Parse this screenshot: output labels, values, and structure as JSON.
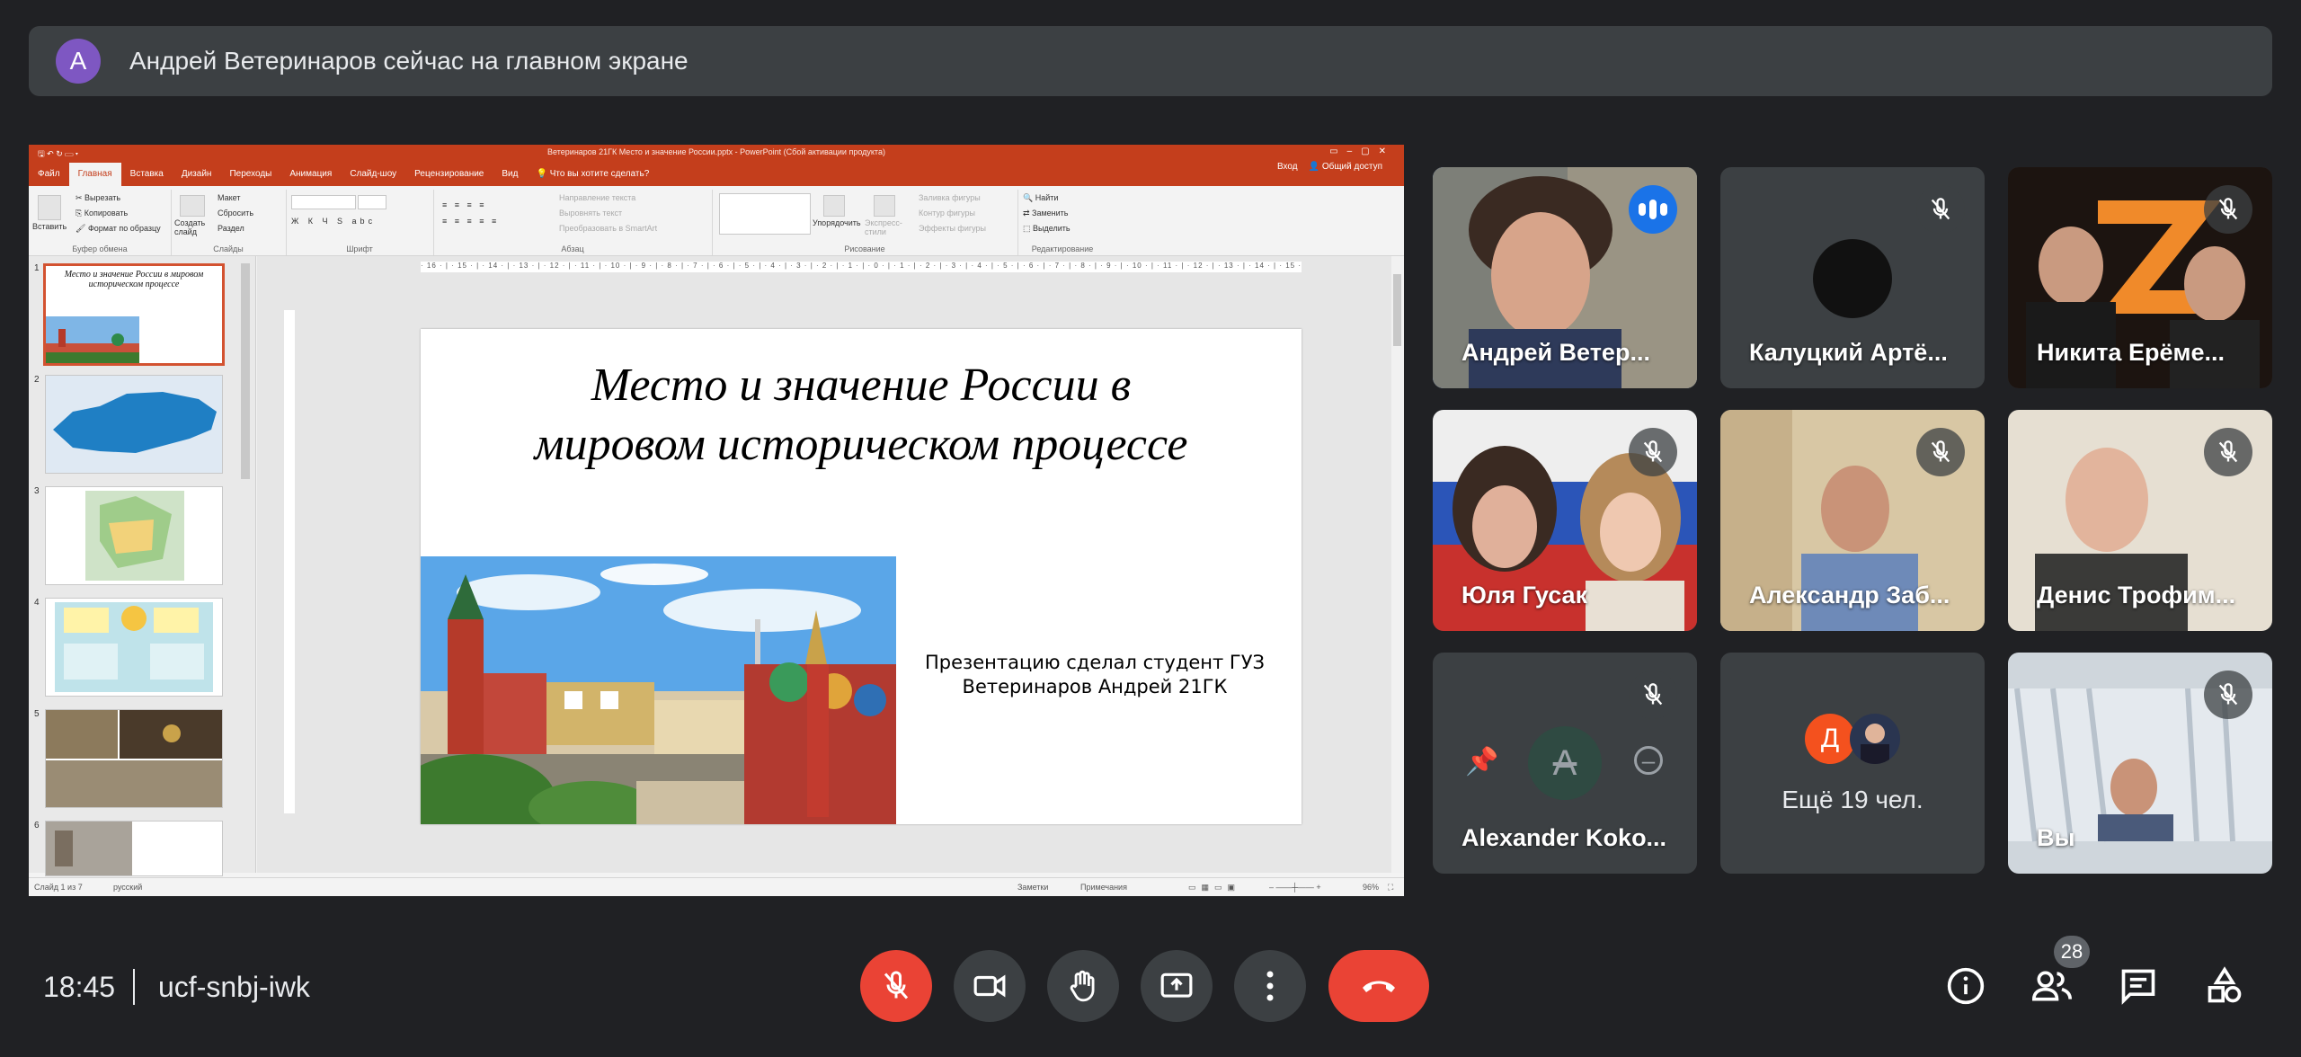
{
  "banner": {
    "avatar_letter": "А",
    "text": "Андрей Ветеринаров сейчас на главном экране"
  },
  "powerpoint": {
    "window_title": "Ветеринаров 21ГК Место и значение России.pptx - PowerPoint (Сбой активации продукта)",
    "tabs": [
      "Файл",
      "Главная",
      "Вставка",
      "Дизайн",
      "Переходы",
      "Анимация",
      "Слайд-шоу",
      "Рецензирование",
      "Вид"
    ],
    "tell_me": "Что вы хотите сделать?",
    "sign_in": "Вход",
    "share": "Общий доступ",
    "ribbon": {
      "paste": "Вставить",
      "cut": "Вырезать",
      "copy": "Копировать",
      "format_painter": "Формат по образцу",
      "clipboard": "Буфер обмена",
      "new_slide": "Создать слайд",
      "layout": "Макет",
      "reset": "Сбросить",
      "section": "Раздел",
      "slides": "Слайды",
      "font": "Шрифт",
      "text_direction": "Направление текста",
      "align_text": "Выровнять текст",
      "smartart": "Преобразовать в SmartArt",
      "paragraph": "Абзац",
      "arrange": "Упорядочить",
      "quick_styles": "Экспресс-стили",
      "shape_fill": "Заливка фигуры",
      "shape_outline": "Контур фигуры",
      "shape_effects": "Эффекты фигуры",
      "drawing": "Рисование",
      "find": "Найти",
      "replace": "Заменить",
      "select": "Выделить",
      "editing": "Редактирование"
    },
    "thumbnails": [
      {
        "num": "1",
        "title": "Место и значение России в мировом историческом процессе"
      },
      {
        "num": "2"
      },
      {
        "num": "3"
      },
      {
        "num": "4"
      },
      {
        "num": "5"
      },
      {
        "num": "6"
      }
    ],
    "ruler": "· 16 · | · 15 · | · 14 · | · 13 · | · 12 · | · 11 · | · 10 · | · 9 · | · 8 · | · 7 · | · 6 · | · 5 · | · 4 · | · 3 · | · 2 · | · 1 · | · 0 · | · 1 · | · 2 · | · 3 · | · 4 · | · 5 · | · 6 · | · 7 · | · 8 · | · 9 · | · 10 · | · 11 · | · 12 · | · 13 · | · 14 · | · 15 · | · 16 ·",
    "slide": {
      "title": "Место и значение России в мировом историческом процессе",
      "subtitle": "Презентацию сделал студент ГУЗ Ветеринаров Андрей 21ГК"
    },
    "status": {
      "slide": "Слайд 1 из 7",
      "lang": "русский",
      "notes": "Заметки",
      "comments": "Примечания",
      "zoom": "96%"
    }
  },
  "participants": [
    {
      "name": "Андрей Ветер...",
      "state": "speaking"
    },
    {
      "name": "Калуцкий Артё...",
      "state": "muted"
    },
    {
      "name": "Никита Ерёме...",
      "state": "muted"
    },
    {
      "name": "Юля Гусак",
      "state": "muted"
    },
    {
      "name": "Александр Заб...",
      "state": "muted"
    },
    {
      "name": "Денис Трофим...",
      "state": "muted"
    },
    {
      "name": "Alexander Koko...",
      "state": "muted",
      "avatar_letter": "A"
    },
    {
      "name": "Ещё 19 чел.",
      "avatar_letter": "Д"
    },
    {
      "name": "Вы",
      "state": "muted"
    }
  ],
  "bottom": {
    "time": "18:45",
    "meeting_code": "ucf-snbj-iwk",
    "participant_count": "28"
  },
  "colors": {
    "accent_blue": "#8ab4f8",
    "end_call_red": "#ea4335",
    "ppt_orange": "#c43e1c"
  }
}
